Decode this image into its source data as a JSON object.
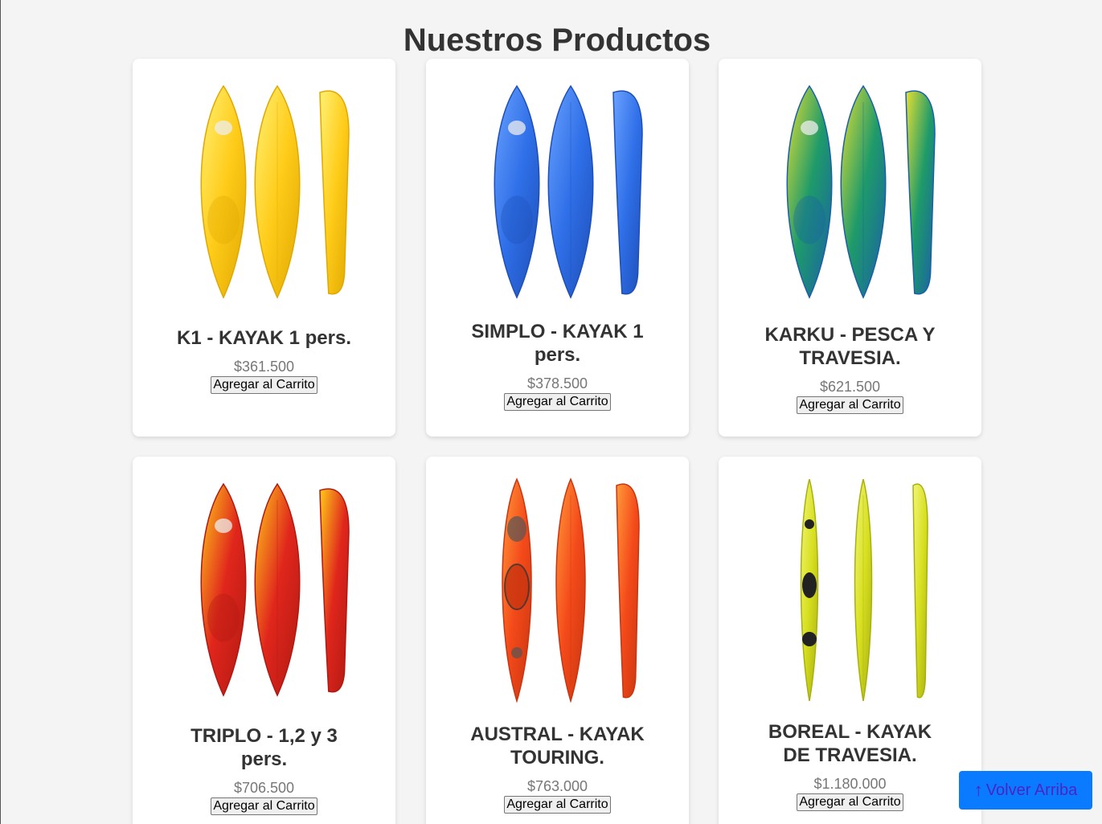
{
  "page": {
    "title": "Nuestros Productos"
  },
  "products": [
    {
      "name": "K1 - KAYAK 1 pers.",
      "price": "$361.500",
      "button": "Agregar al Carrito",
      "colors": {
        "main": "#ffcc1a",
        "dark": "#e0a800",
        "accent": "#fff176"
      }
    },
    {
      "name": "SIMPLO - KAYAK 1 pers.",
      "price": "$378.500",
      "button": "Agregar al Carrito",
      "colors": {
        "main": "#2f6fe8",
        "dark": "#1e4fb8",
        "accent": "#6aa2ff"
      }
    },
    {
      "name": "KARKU - PESCA Y TRAVESIA.",
      "price": "$621.500",
      "button": "Agregar al Carrito",
      "colors": {
        "main": "#1e9a6a",
        "dark": "#1a5fa8",
        "accent": "#e6e033"
      }
    },
    {
      "name": "TRIPLO - 1,2 y 3 pers.",
      "price": "$706.500",
      "button": "Agregar al Carrito",
      "colors": {
        "main": "#e0261c",
        "dark": "#b01912",
        "accent": "#ffcc1a"
      }
    },
    {
      "name": "AUSTRAL - KAYAK TOURING.",
      "price": "$763.000",
      "button": "Agregar al Carrito",
      "colors": {
        "main": "#f44a1a",
        "dark": "#c93510",
        "accent": "#ff9a3a"
      }
    },
    {
      "name": "BOREAL - KAYAK DE TRAVESIA.",
      "price": "$1.180.000",
      "button": "Agregar al Carrito",
      "colors": {
        "main": "#d8e020",
        "dark": "#a8b010",
        "accent": "#f2f57a"
      }
    }
  ],
  "back_to_top": {
    "arrow": "↑",
    "label": "Volver Arriba",
    "color": "#0a7bff"
  }
}
